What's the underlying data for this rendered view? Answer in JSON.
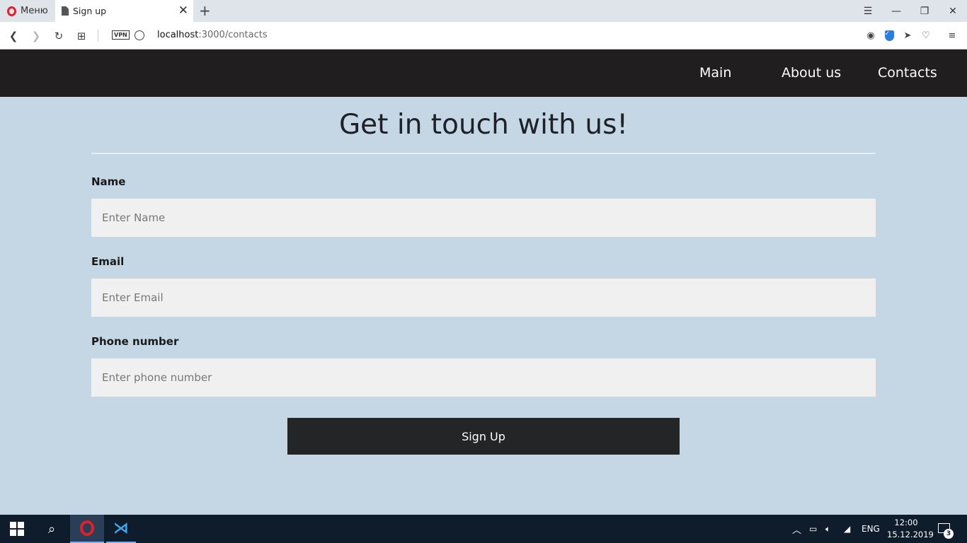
{
  "browser": {
    "menu_label": "Меню",
    "tab_title": "Sign up",
    "url_host": "localhost",
    "url_path": ":3000/contacts",
    "vpn_label": "VPN"
  },
  "nav": {
    "links": [
      "Main",
      "About us",
      "Contacts"
    ]
  },
  "form": {
    "heading": "Get in touch with us!",
    "name_label": "Name",
    "name_placeholder": "Enter Name",
    "email_label": "Email",
    "email_placeholder": "Enter Email",
    "phone_label": "Phone number",
    "phone_placeholder": "Enter phone number",
    "submit_label": "Sign Up"
  },
  "taskbar": {
    "language": "ENG",
    "time": "12:00",
    "date": "15.12.2019",
    "notification_count": "3"
  },
  "colors": {
    "page_background": "#c5d6e5",
    "navbar": "#201e1e",
    "button": "#242526",
    "opera_red": "#e0202a"
  }
}
